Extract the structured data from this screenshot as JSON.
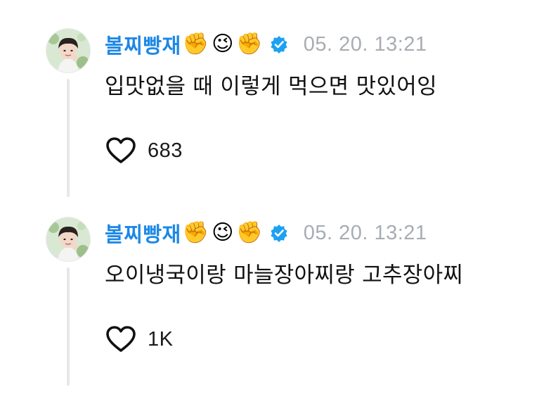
{
  "comments": [
    {
      "username": "볼찌빵재",
      "emojis": [
        "✊",
        "😉",
        "✊"
      ],
      "timestamp": "05. 20. 13:21",
      "text": "입맛없을 때 이렇게 먹으면 맛있어잉",
      "likes": "683",
      "avatar_icon": "profile-photo",
      "verified_icon": "verified-badge-icon"
    },
    {
      "username": "볼찌빵재",
      "emojis": [
        "✊",
        "😉",
        "✊"
      ],
      "timestamp": "05. 20. 13:21",
      "text": "오이냉국이랑 마늘장아찌랑 고추장아찌",
      "likes": "1K",
      "avatar_icon": "profile-photo",
      "verified_icon": "verified-badge-icon"
    }
  ],
  "colors": {
    "username": "#1e88e5",
    "timestamp": "#a8adb3",
    "text": "#111111",
    "verified_badge": "#1da1f2",
    "thread_line": "#e5e7ea"
  }
}
